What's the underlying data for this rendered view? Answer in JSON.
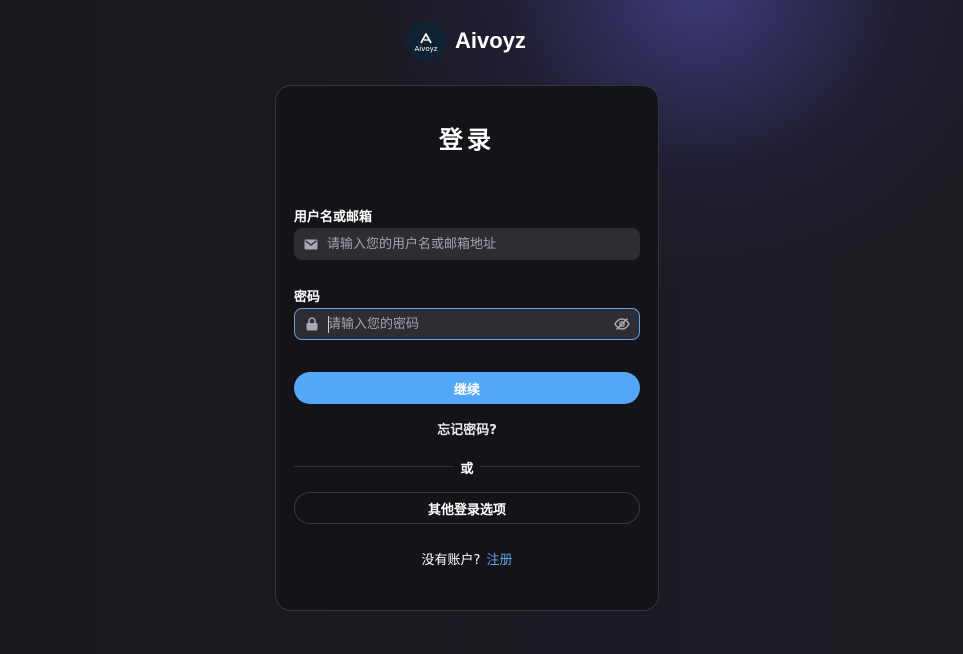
{
  "brand": {
    "name": "Aivoyz",
    "logo_text": "Aivoyz"
  },
  "login": {
    "title": "登录",
    "username": {
      "label": "用户名或邮箱",
      "placeholder": "请输入您的用户名或邮箱地址",
      "value": "",
      "icon": "mail-icon"
    },
    "password": {
      "label": "密码",
      "placeholder": "请输入您的密码",
      "value": "",
      "icon": "lock-icon",
      "toggle_icon": "eye-off-icon"
    },
    "continue_label": "继续",
    "forgot_label": "忘记密码?",
    "or_label": "或",
    "other_options_label": "其他登录选项",
    "signup_prompt": "没有账户?",
    "signup_link": "注册"
  },
  "colors": {
    "primary": "#53a7f8",
    "link": "#5aa6ee",
    "card_bg": "#141318",
    "input_bg": "#2e2d34"
  }
}
